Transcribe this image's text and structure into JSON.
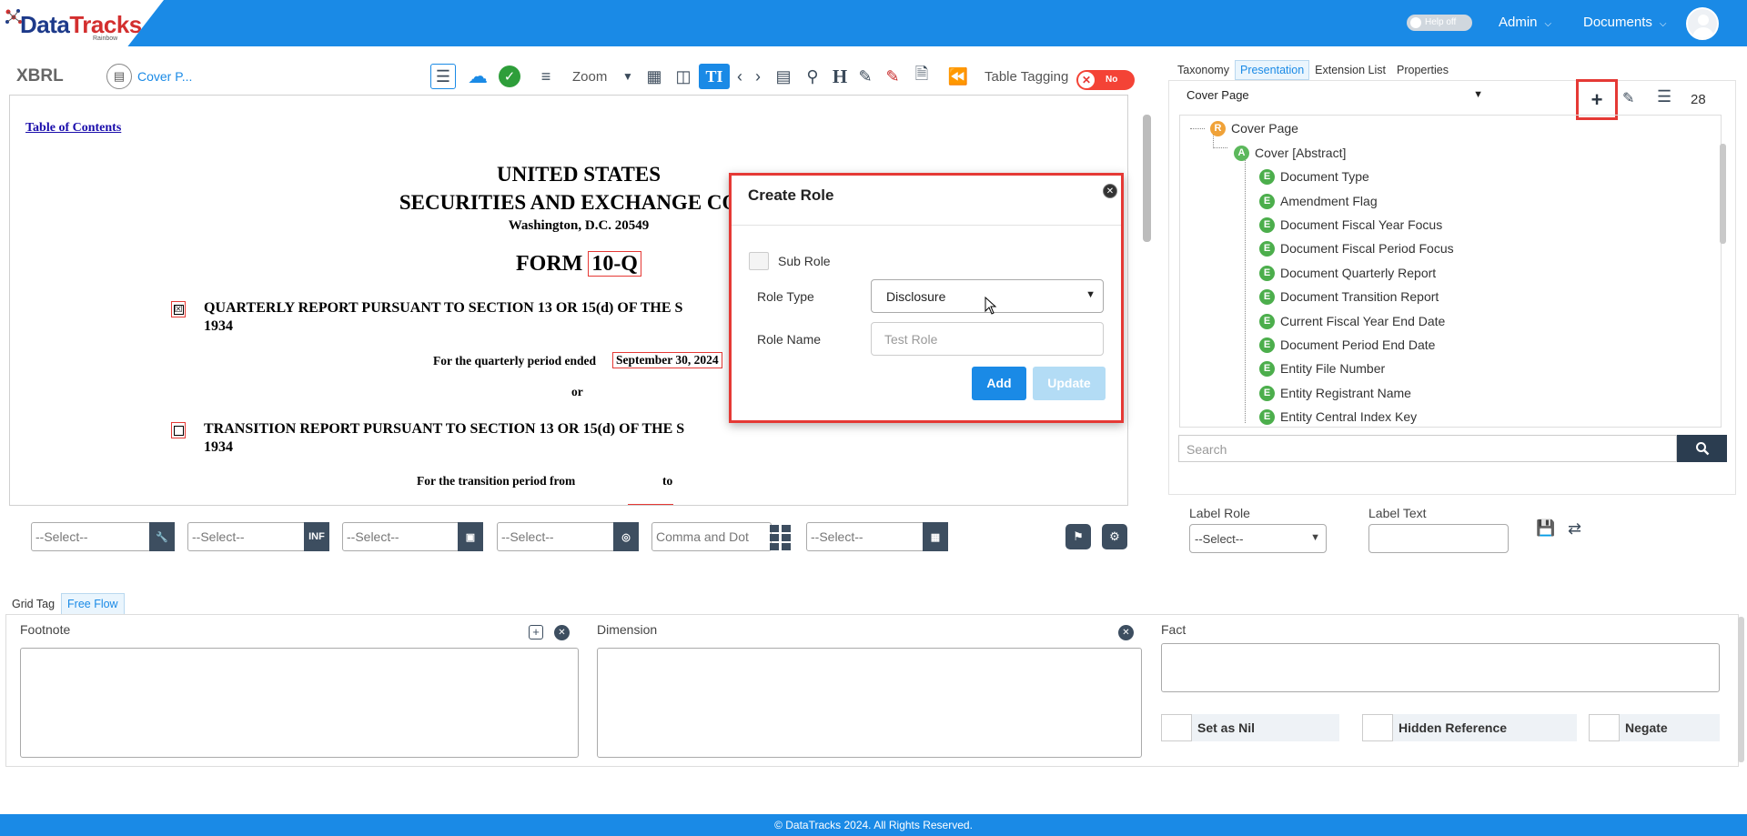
{
  "header": {
    "logo_main": "Data",
    "logo_accent": "Tracks",
    "logo_sub": "Rainbow",
    "help_toggle": "Help off",
    "admin_menu": "Admin",
    "documents_menu": "Documents"
  },
  "toolbar": {
    "xbrl_label": "XBRL",
    "cover_label": "Cover P...",
    "zoom_label": "Zoom",
    "table_tagging_label": "Table Tagging",
    "table_tagging_toggle": "No"
  },
  "document": {
    "toc_link": "Table of Contents",
    "line1": "UNITED STATES",
    "line2": "SECURITIES AND EXCHANGE COM",
    "line3": "Washington, D.C. 20549",
    "form_prefix": "FORM",
    "form_type": "10-Q",
    "quarterly_report": "QUARTERLY REPORT PURSUANT TO SECTION 13 OR 15(d) OF THE S",
    "year1": "1934",
    "quarterly_period_label": "For the quarterly period ended",
    "quarterly_period_date": "September 30, 2024",
    "or_text": "or",
    "transition_report": "TRANSITION REPORT PURSUANT TO SECTION 13 OR 15(d) OF THE S",
    "year2": "1934",
    "transition_from": "For the transition period from",
    "transition_to": "to",
    "quarterly_checkbox": "☒",
    "transition_checkbox": ""
  },
  "modal": {
    "title": "Create Role",
    "sub_role_label": "Sub Role",
    "role_type_label": "Role Type",
    "role_type_value": "Disclosure",
    "role_name_label": "Role Name",
    "role_name_placeholder": "Test Role",
    "add_button": "Add",
    "update_button": "Update"
  },
  "right_panel": {
    "tabs": [
      "Taxonomy",
      "Presentation",
      "Extension List",
      "Properties"
    ],
    "active_tab": "Presentation",
    "role_select_value": "Cover Page",
    "role_count": "28",
    "tree": [
      {
        "badge": "R",
        "label": "Cover Page"
      },
      {
        "badge": "A",
        "label": "Cover [Abstract]"
      },
      {
        "badge": "E",
        "label": "Document Type"
      },
      {
        "badge": "E",
        "label": "Amendment Flag"
      },
      {
        "badge": "E",
        "label": "Document Fiscal Year Focus"
      },
      {
        "badge": "E",
        "label": "Document Fiscal Period Focus"
      },
      {
        "badge": "E",
        "label": "Document Quarterly Report"
      },
      {
        "badge": "E",
        "label": "Document Transition Report"
      },
      {
        "badge": "E",
        "label": "Current Fiscal Year End Date"
      },
      {
        "badge": "E",
        "label": "Document Period End Date"
      },
      {
        "badge": "E",
        "label": "Entity File Number"
      },
      {
        "badge": "E",
        "label": "Entity Registrant Name"
      },
      {
        "badge": "E",
        "label": "Entity Central Index Key"
      }
    ],
    "search_placeholder": "Search",
    "label_role_title": "Label Role",
    "label_role_value": "--Select--",
    "label_text_title": "Label Text"
  },
  "filters": {
    "select1": "--Select--",
    "select2": "--Select--",
    "select3": "--Select--",
    "select4": "--Select--",
    "number_format": "Comma and Dot",
    "select6": "--Select--",
    "inf_label": "INF"
  },
  "bottom": {
    "tabs": [
      "Grid Tag",
      "Free Flow"
    ],
    "active_tab": "Free Flow",
    "footnote_title": "Footnote",
    "dimension_title": "Dimension",
    "fact_title": "Fact",
    "set_as_nil": "Set as Nil",
    "hidden_reference": "Hidden Reference",
    "negate": "Negate"
  },
  "footer": {
    "copyright": "© DataTracks 2024. All Rights Reserved."
  }
}
